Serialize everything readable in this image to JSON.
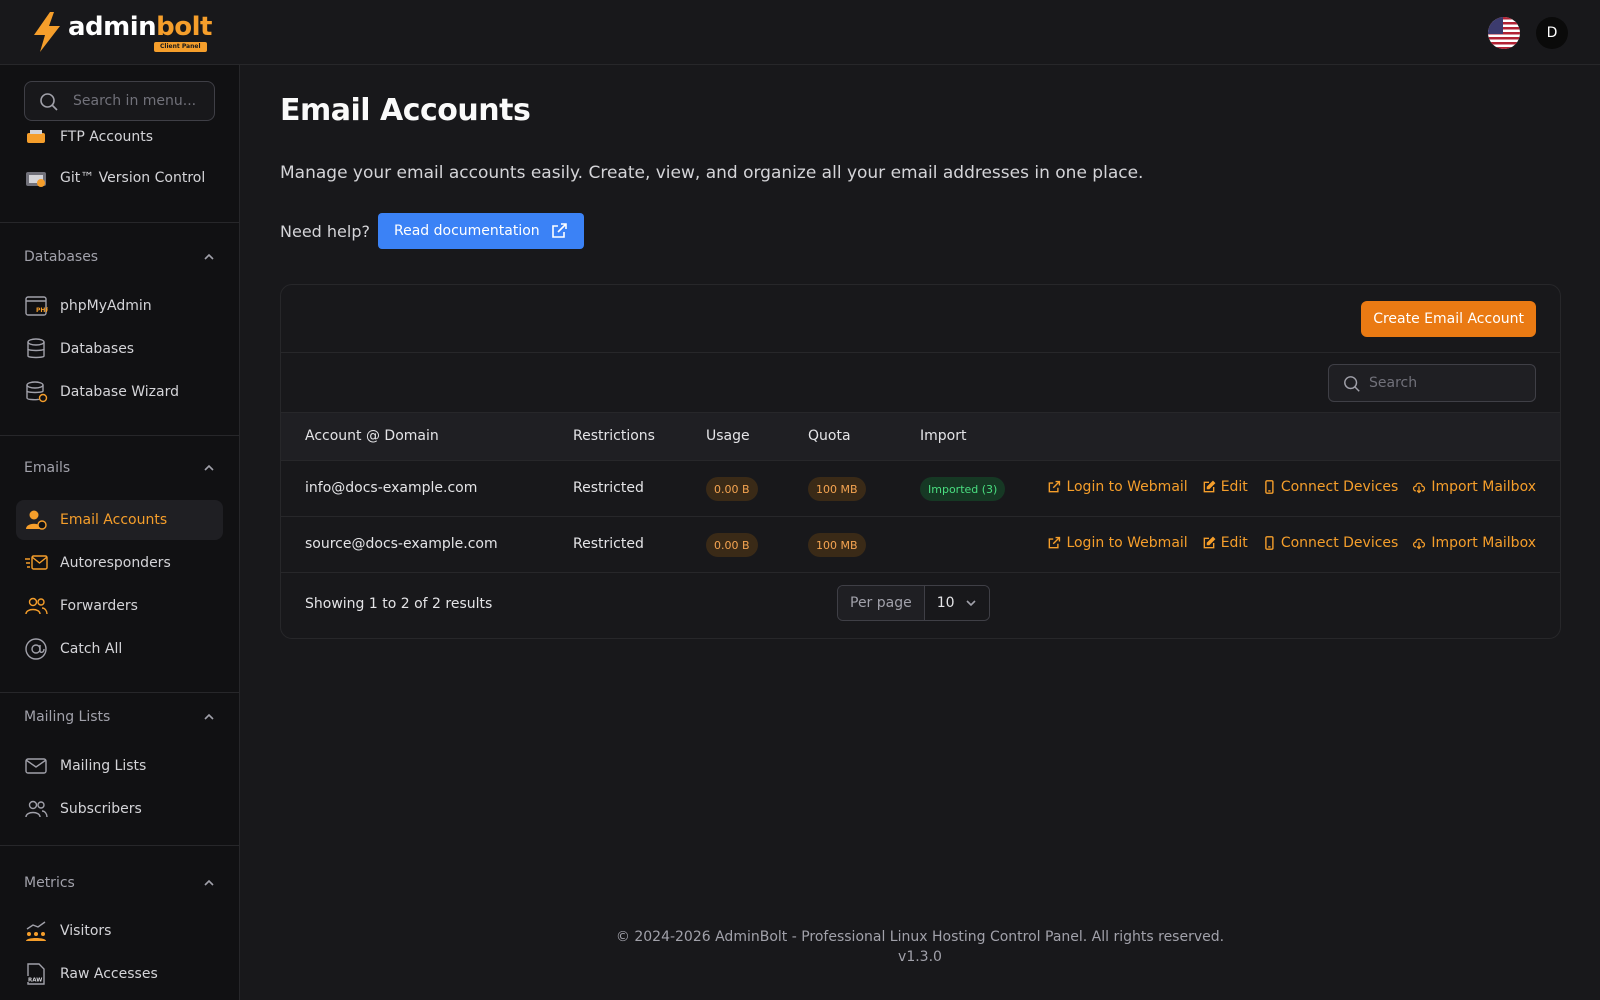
{
  "brand": {
    "name_part1": "admin",
    "name_part2": "bolt",
    "badge": "Client Panel",
    "accent": "#f59e2b"
  },
  "header": {
    "avatar_initial": "D",
    "flag": "us-flag"
  },
  "sidebar": {
    "search_placeholder": "Search in menu...",
    "files_items": [
      {
        "label": "FTP Accounts",
        "icon": "ftp-icon"
      },
      {
        "label": "Git™ Version Control",
        "icon": "git-icon"
      }
    ],
    "sections": {
      "databases": {
        "title": "Databases",
        "items": [
          {
            "label": "phpMyAdmin",
            "icon": "phpmyadmin-icon"
          },
          {
            "label": "Databases",
            "icon": "database-icon"
          },
          {
            "label": "Database Wizard",
            "icon": "database-wizard-icon"
          }
        ]
      },
      "emails": {
        "title": "Emails",
        "items": [
          {
            "label": "Email Accounts",
            "icon": "email-account-icon",
            "active": true
          },
          {
            "label": "Autoresponders",
            "icon": "autoresponder-icon"
          },
          {
            "label": "Forwarders",
            "icon": "forwarders-icon"
          },
          {
            "label": "Catch All",
            "icon": "at-icon"
          }
        ]
      },
      "mailing": {
        "title": "Mailing Lists",
        "items": [
          {
            "label": "Mailing Lists",
            "icon": "envelope-icon"
          },
          {
            "label": "Subscribers",
            "icon": "subscribers-icon"
          }
        ]
      },
      "metrics": {
        "title": "Metrics",
        "items": [
          {
            "label": "Visitors",
            "icon": "visitors-icon"
          },
          {
            "label": "Raw Accesses",
            "icon": "raw-file-icon"
          }
        ]
      }
    }
  },
  "page": {
    "title": "Email Accounts",
    "description": "Manage your email accounts easily. Create, view, and organize all your email addresses in one place.",
    "help_text": "Need help?",
    "doc_button": "Read documentation"
  },
  "table": {
    "create_button": "Create Email Account",
    "search_placeholder": "Search",
    "columns": [
      "Account @ Domain",
      "Restrictions",
      "Usage",
      "Quota",
      "Import"
    ],
    "rows": [
      {
        "account": "info@docs-example.com",
        "restrictions": "Restricted",
        "usage": "0.00 B",
        "quota": "100 MB",
        "import": "Imported (3)"
      },
      {
        "account": "source@docs-example.com",
        "restrictions": "Restricted",
        "usage": "0.00 B",
        "quota": "100 MB",
        "import": ""
      }
    ],
    "actions": {
      "webmail": "Login to Webmail",
      "edit": "Edit",
      "devices": "Connect Devices",
      "import": "Import Mailbox"
    },
    "showing": "Showing 1 to 2 of 2 results",
    "per_page_label": "Per page",
    "per_page_value": "10"
  },
  "footer": {
    "copyright": "© 2024-2026 AdminBolt - Professional Linux Hosting Control Panel. All rights reserved.",
    "version": "v1.3.0"
  }
}
